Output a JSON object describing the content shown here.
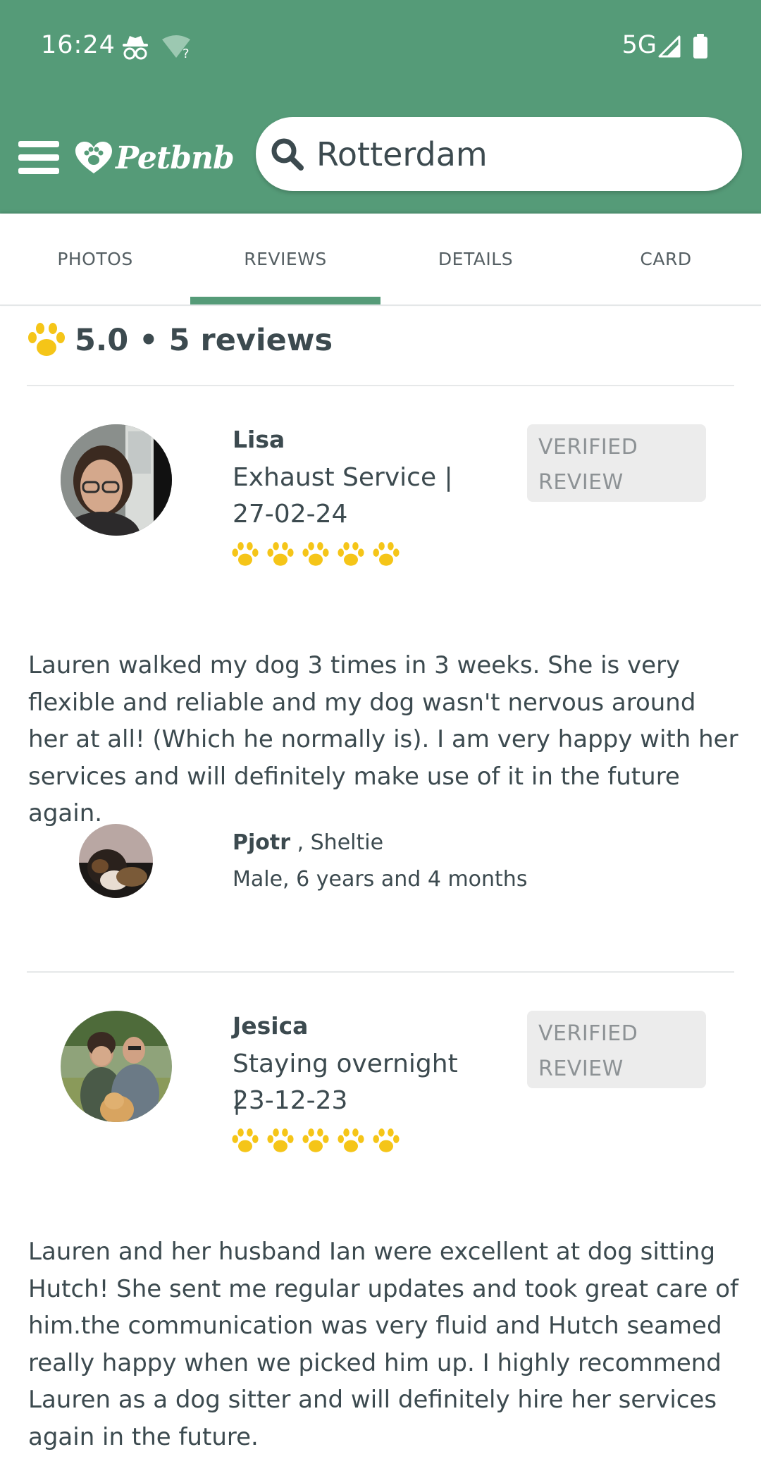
{
  "status_bar": {
    "time": "16:24",
    "network": "5G"
  },
  "header": {
    "logo_text": "Petbnb",
    "search_value": "Rotterdam"
  },
  "tabs": [
    {
      "label": "PHOTOS"
    },
    {
      "label": "REVIEWS"
    },
    {
      "label": "DETAILS"
    },
    {
      "label": "CARD"
    }
  ],
  "summary": {
    "text": "5.0 • 5 reviews",
    "rating": 5.0,
    "count": 5
  },
  "reviews": [
    {
      "name": "Lisa",
      "service_line": "Exhaust Service |",
      "date": "27-02-24",
      "rating": 5,
      "badge_line1": "VERIFIED",
      "badge_line2": "REVIEW",
      "text": "Lauren walked my dog 3 times in 3 weeks. She is very flexible and reliable and my dog wasn't nervous around her at all! (Which he normally is). I am very happy with her services and will definitely make use of it in the future again.",
      "pet_name": "Pjotr",
      "pet_breed": " , Sheltie",
      "pet_details": "Male, 6 years and 4 months"
    },
    {
      "name": "Jesica",
      "service_line": "Staying overnight |",
      "date": "23-12-23",
      "rating": 5,
      "badge_line1": "VERIFIED",
      "badge_line2": "REVIEW",
      "text": "Lauren and her husband Ian were excellent at dog sitting Hutch! She sent me regular updates and took great care of him.the communication was very fluid and Hutch seamed really happy when we picked him up. I highly recommend Lauren as a dog sitter and will definitely hire her services again in the future."
    }
  ],
  "colors": {
    "brand_green": "#559b78",
    "paw_yellow": "#f5c518",
    "text_dark": "#3c4a4f",
    "badge_bg": "#ececec"
  },
  "icons": {
    "menu": "hamburger-icon",
    "search": "search-icon",
    "rating": "paw-icon"
  }
}
